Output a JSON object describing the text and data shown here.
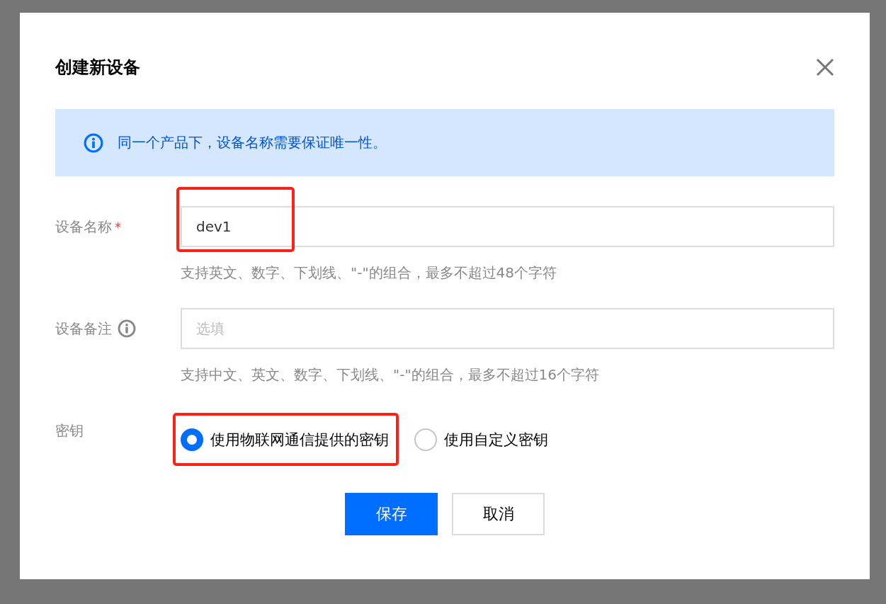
{
  "dialog": {
    "title": "创建新设备"
  },
  "alert": {
    "text": "同一个产品下，设备名称需要保证唯一性。"
  },
  "fields": [
    {
      "label": "设备名称",
      "required_mark": "*",
      "info_icon": false,
      "value": "dev1",
      "highlighted": true,
      "help": "支持英文、数字、下划线、\"-\"的组合，最多不超过48个字符"
    },
    {
      "label": "设备备注",
      "info_icon": true,
      "placeholder": "选填",
      "highlighted": false,
      "help": "支持中文、英文、数字、下划线、\"-\"的组合，最多不超过16个字符"
    }
  ],
  "key_setting": {
    "label": "密钥",
    "options": [
      {
        "label": "使用物联网通信提供的密钥",
        "selected": true,
        "highlighted": true
      },
      {
        "label": "使用自定义密钥",
        "selected": false,
        "highlighted": false
      }
    ]
  },
  "buttons": [
    {
      "kind": "primary",
      "label": "保存"
    },
    {
      "kind": "secondary",
      "label": "取消"
    }
  ]
}
